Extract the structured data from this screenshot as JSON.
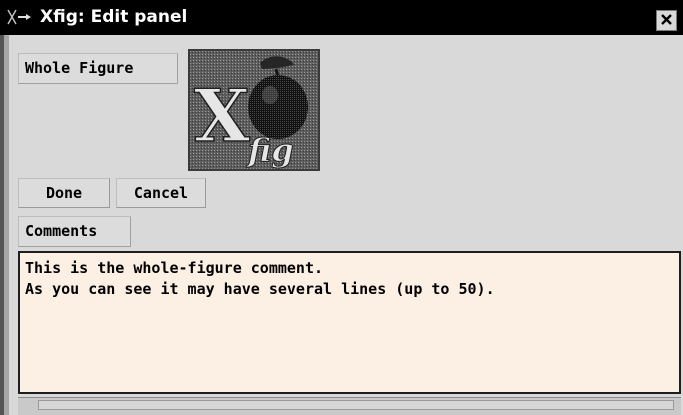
{
  "window": {
    "title": "Xfig: Edit panel"
  },
  "panel": {
    "object_label": "Whole Figure",
    "logo_text_main": "X",
    "logo_text_sub": "fig"
  },
  "buttons": {
    "done_label": "Done",
    "cancel_label": "Cancel"
  },
  "comments": {
    "label": "Comments",
    "lines": [
      "This is the whole-figure comment.",
      "As you can see it may have several lines (up to 50)."
    ]
  },
  "icons": {
    "window_menu": "xfig-logo-icon",
    "close": "close-icon",
    "image": "xfig-logo-image"
  },
  "colors": {
    "titlebar": "#000000",
    "panel_bg": "#d9d9d9",
    "comments_bg": "#fcefe4"
  }
}
